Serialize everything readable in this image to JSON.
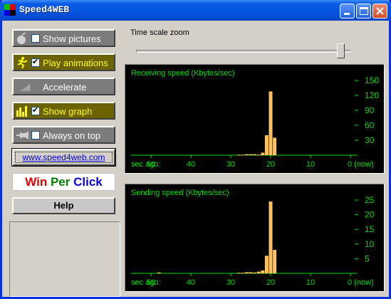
{
  "window": {
    "title": "Speed4WEB"
  },
  "options": [
    {
      "id": "show-pictures",
      "label": "Show pictures",
      "checked": false,
      "active": false,
      "icon": "apple-icon"
    },
    {
      "id": "play-animations",
      "label": "Play animations",
      "checked": true,
      "active": true,
      "icon": "running-man-icon"
    },
    {
      "id": "accelerate",
      "label": "Accelerate",
      "checked": null,
      "active": false,
      "icon": "ramp-icon"
    },
    {
      "id": "show-graph",
      "label": "Show graph",
      "checked": true,
      "active": true,
      "icon": "bar-graph-icon"
    },
    {
      "id": "always-on-top",
      "label": "Always on top",
      "checked": false,
      "active": false,
      "icon": "pin-icon"
    }
  ],
  "link": {
    "label": "www.speed4web.com"
  },
  "wpc": {
    "win": "Win",
    "per": "Per",
    "click": "Click"
  },
  "help": {
    "label": "Help"
  },
  "zoom": {
    "label": "Time scale zoom",
    "value": 0.97
  },
  "receiving": {
    "title": "Receiving speed (Kbytes/sec)",
    "axis_label": "sec ago:",
    "x_ticks": [
      "50",
      "40",
      "30",
      "20",
      "10",
      "0 (now)"
    ],
    "y_ticks": [
      "150",
      "120",
      "90",
      "60",
      "30"
    ],
    "y_max": 150
  },
  "sending": {
    "title": "Sending speed (Kbytes/sec)",
    "axis_label": "sec ago:",
    "x_ticks": [
      "50",
      "40",
      "30",
      "20",
      "10",
      "0 (now)"
    ],
    "y_ticks": [
      "25",
      "20",
      "15",
      "10",
      "5"
    ],
    "y_max": 25
  },
  "chart_data": [
    {
      "type": "bar",
      "title": "Receiving speed (Kbytes/sec)",
      "xlabel": "sec ago:",
      "xlim": [
        55,
        0
      ],
      "ylim": [
        0,
        150
      ],
      "x": [
        28,
        27,
        26,
        25,
        24,
        23,
        22,
        21,
        20,
        19
      ],
      "values": [
        1,
        1,
        2,
        2,
        2,
        1,
        5,
        40,
        128,
        35
      ],
      "color": "#ffc060"
    },
    {
      "type": "bar",
      "title": "Sending speed (Kbytes/sec)",
      "xlabel": "sec ago:",
      "xlim": [
        55,
        0
      ],
      "ylim": [
        0,
        25
      ],
      "x": [
        48,
        28,
        27,
        26,
        25,
        24,
        23,
        22,
        21,
        20,
        19
      ],
      "values": [
        0.3,
        0.2,
        0.2,
        0.4,
        0.4,
        0.3,
        0.6,
        1.0,
        6,
        24.5,
        8
      ],
      "color": "#ffc060"
    }
  ]
}
